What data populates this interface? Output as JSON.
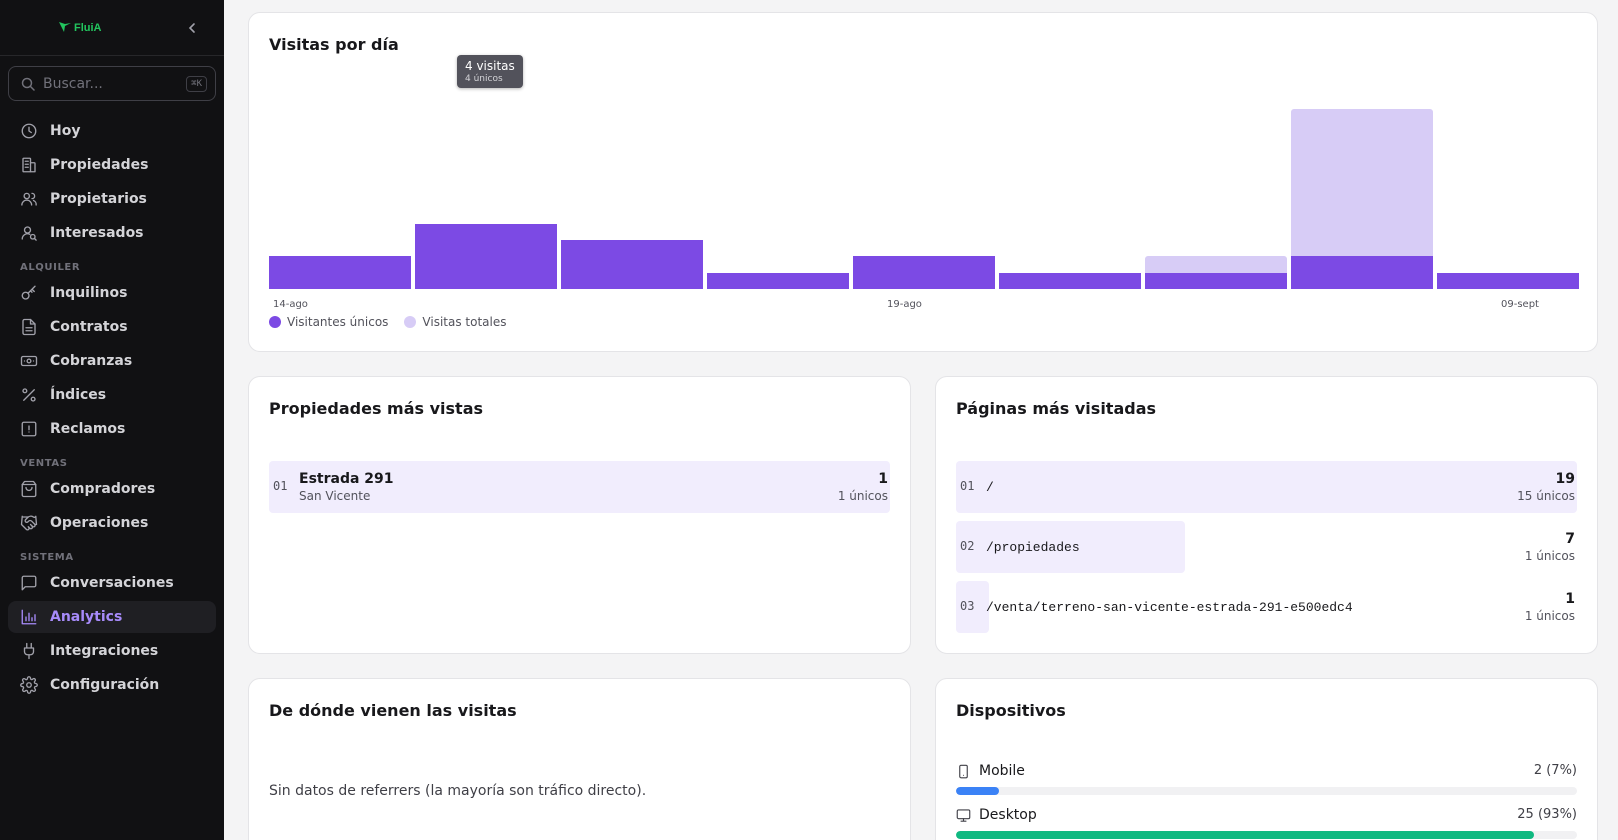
{
  "sidebar": {
    "brand": "FluiA",
    "search": {
      "placeholder": "Buscar...",
      "shortcut": "⌘K"
    },
    "items_main": [
      {
        "label": "Hoy",
        "icon": "clock-icon"
      },
      {
        "label": "Propiedades",
        "icon": "building-icon"
      },
      {
        "label": "Propietarios",
        "icon": "users-icon"
      },
      {
        "label": "Interesados",
        "icon": "user-search-icon"
      }
    ],
    "section_alquiler": "ALQUILER",
    "items_alquiler": [
      {
        "label": "Inquilinos",
        "icon": "key-icon"
      },
      {
        "label": "Contratos",
        "icon": "file-icon"
      },
      {
        "label": "Cobranzas",
        "icon": "banknote-icon"
      },
      {
        "label": "Índices",
        "icon": "percent-icon"
      },
      {
        "label": "Reclamos",
        "icon": "alert-icon"
      }
    ],
    "section_ventas": "VENTAS",
    "items_ventas": [
      {
        "label": "Compradores",
        "icon": "shopping-bag-icon"
      },
      {
        "label": "Operaciones",
        "icon": "handshake-icon"
      }
    ],
    "section_sistema": "SISTEMA",
    "items_sistema": [
      {
        "label": "Conversaciones",
        "icon": "message-icon"
      },
      {
        "label": "Analytics",
        "icon": "chart-icon",
        "active": true
      },
      {
        "label": "Integraciones",
        "icon": "plug-icon"
      },
      {
        "label": "Configuración",
        "icon": "gear-icon"
      }
    ]
  },
  "visits_chart": {
    "title": "Visitas por día",
    "tooltip": {
      "visits": "4 visitas",
      "uniques": "4 únicos"
    },
    "legend_unique": "Visitantes únicos",
    "legend_total": "Visitas totales",
    "colors": {
      "unique": "#7c4ae4",
      "total": "#d7ccf6"
    }
  },
  "chart_data": {
    "type": "bar",
    "title": "Visitas por día",
    "x_tick_labels": [
      "14-ago",
      "19-ago",
      "09-sept"
    ],
    "series": [
      {
        "name": "Visitantes únicos",
        "values": [
          2,
          4,
          3,
          1,
          2,
          1,
          1,
          2,
          1
        ]
      },
      {
        "name": "Visitas totales",
        "values": [
          2,
          4,
          3,
          1,
          2,
          1,
          2,
          11,
          1
        ]
      }
    ],
    "ylim": [
      0,
      12
    ],
    "grid": false,
    "legend": "bottom-left"
  },
  "top_properties": {
    "title": "Propiedades más vistas",
    "rows": [
      {
        "idx": "01",
        "name": "Estrada 291",
        "sub": "San Vicente",
        "count": "1",
        "uniques": "1 únicos",
        "share": 1.0
      }
    ]
  },
  "top_pages": {
    "title": "Páginas más visitadas",
    "rows": [
      {
        "idx": "01",
        "path": "/",
        "count": "19",
        "uniques": "15 únicos",
        "share": 1.0
      },
      {
        "idx": "02",
        "path": "/propiedades",
        "count": "7",
        "uniques": "1 únicos",
        "share": 0.368
      },
      {
        "idx": "03",
        "path": "/venta/terreno-san-vicente-estrada-291-e500edc4",
        "count": "1",
        "uniques": "1 únicos",
        "share": 0.053
      }
    ]
  },
  "referrers": {
    "title": "De dónde vienen las visitas",
    "empty": "Sin datos de referrers (la mayoría son tráfico directo)."
  },
  "devices": {
    "title": "Dispositivos",
    "items": [
      {
        "label": "Mobile",
        "value": "2 (7%)",
        "fraction": 0.07,
        "color": "#3b82f6",
        "icon": "smartphone-icon"
      },
      {
        "label": "Desktop",
        "value": "25 (93%)",
        "fraction": 0.93,
        "color": "#10b981",
        "icon": "monitor-icon"
      }
    ]
  }
}
